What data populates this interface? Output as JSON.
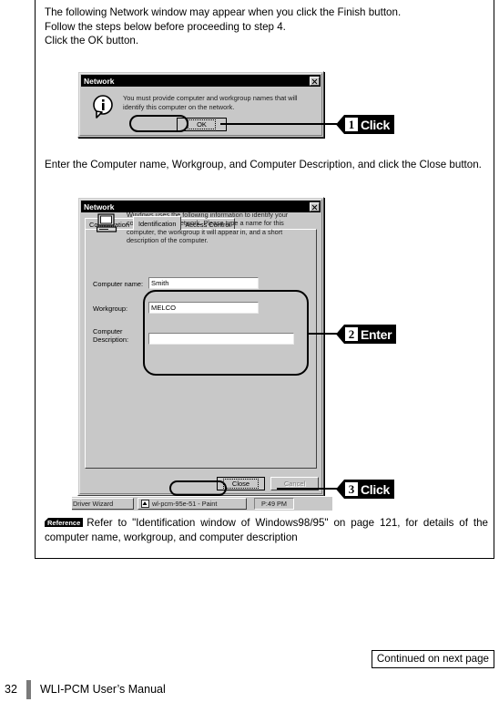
{
  "page": {
    "number": "32",
    "manual_title": "WLI-PCM User’s Manual",
    "continued_note": "Continued on next page"
  },
  "intro_paragraph": "The following Network window may appear when you click the Finish button.\nFollow the steps below before proceeding to step 4.\nClick the OK button.",
  "intro_lines": {
    "line1": "The following Network window may appear when you click the Finish button.",
    "line2": "Follow the steps below before proceeding to step 4.",
    "line3": "Click the OK button."
  },
  "step2_paragraph": "Enter the Computer name, Workgroup, and Computer Description, and click the Close button.",
  "dialog1": {
    "title": "Network",
    "close_icon": "close-x-icon",
    "info_icon": "information-icon",
    "message": "You must provide computer and workgroup names that will identify this computer on the network.",
    "ok_label": "OK"
  },
  "dialog2": {
    "title": "Network",
    "close_icon": "close-x-icon",
    "computer_icon": "computer-monitor-icon",
    "tabs": [
      {
        "label": "Configuration",
        "active": false
      },
      {
        "label": "Identification",
        "active": true
      },
      {
        "label": "Access Control",
        "active": false
      }
    ],
    "description": "Windows uses the following information to identify your computer on the network.  Please type a name for this computer, the workgroup it will appear in, and a short description of the computer.",
    "fields": {
      "computer_name_label": "Computer name:",
      "computer_name_value": "Smith",
      "workgroup_label": "Workgroup:",
      "workgroup_value": "MELCO",
      "computer_description_label": "Computer\nDescription:",
      "computer_description_label_line1": "Computer",
      "computer_description_label_line2": "Description:",
      "computer_description_value": ""
    },
    "buttons": {
      "close_label": "Close",
      "cancel_label": "Cancel"
    }
  },
  "taskbar": {
    "task1_label": "vice Driver Wizard",
    "task2_label": "wl-pcm-95e-51 - Paint",
    "task2_icon": "paint-app-icon",
    "clock": "P:49 PM"
  },
  "callouts": [
    {
      "number": "1",
      "action": "Click"
    },
    {
      "number": "2",
      "action": "Enter"
    },
    {
      "number": "3",
      "action": "Click"
    }
  ],
  "reference_note": {
    "badge": "Reference",
    "text": "Refer to \"Identification window of Windows98/95\" on page 121, for details of the computer name, workgroup, and computer description"
  }
}
